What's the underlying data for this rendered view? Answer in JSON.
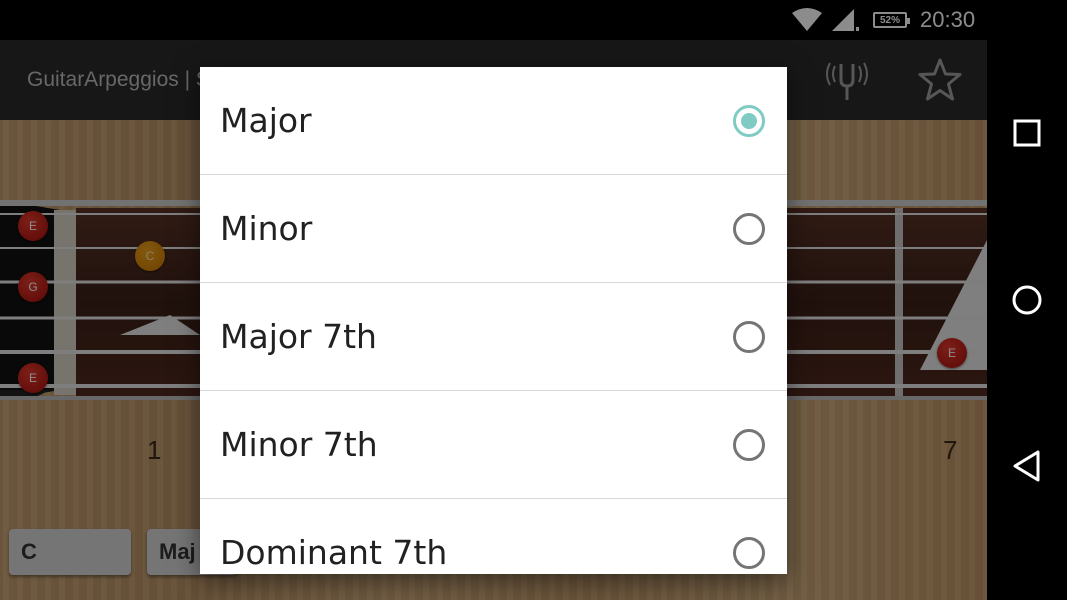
{
  "status_bar": {
    "battery": "52%",
    "time": "20:30"
  },
  "toolbar": {
    "title": "GuitarArpeggios | S"
  },
  "fretboard": {
    "fret_numbers": [
      "1",
      "7"
    ],
    "notes": [
      "E",
      "G",
      "E",
      "C",
      "E"
    ]
  },
  "selectors": {
    "root": "C",
    "type": "Maj"
  },
  "dialog": {
    "options": [
      {
        "label": "Major",
        "selected": true
      },
      {
        "label": "Minor",
        "selected": false
      },
      {
        "label": "Major 7th",
        "selected": false
      },
      {
        "label": "Minor 7th",
        "selected": false
      },
      {
        "label": "Dominant 7th",
        "selected": false
      }
    ]
  },
  "colors": {
    "accent": "#80cbc4",
    "toolbar": "#2b2b2b",
    "note_red": "#c81e16",
    "note_orange": "#e6920e"
  },
  "icons": [
    "wifi-icon",
    "cell-signal-icon",
    "battery-icon",
    "tuner-fork-icon",
    "star-icon",
    "recents-icon",
    "home-icon",
    "back-icon"
  ]
}
